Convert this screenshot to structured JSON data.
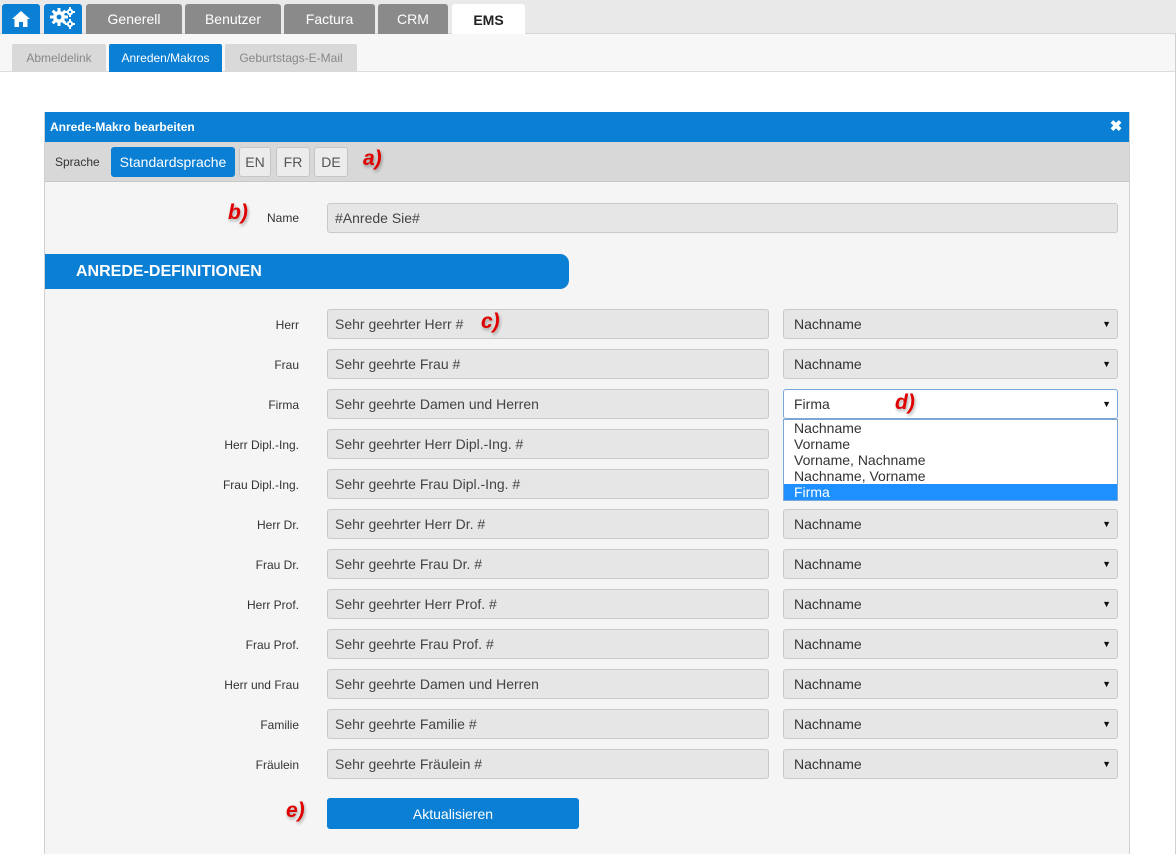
{
  "top_tabs": [
    "Generell",
    "Benutzer",
    "Factura",
    "CRM",
    "EMS"
  ],
  "sub_tabs": [
    "Abmeldelink",
    "Anreden/Makros",
    "Geburtstags-E-Mail"
  ],
  "dialog": {
    "title": "Anrede-Makro bearbeiten",
    "close_glyph": "✖",
    "language_label": "Sprache",
    "languages": [
      "Standardsprache",
      "EN",
      "FR",
      "DE"
    ],
    "name_label": "Name",
    "name_value": "#Anrede Sie#",
    "section_title": "ANREDE-DEFINITIONEN",
    "rows": [
      {
        "label": "Herr",
        "value": "Sehr geehrter Herr #",
        "select": "Nachname"
      },
      {
        "label": "Frau",
        "value": "Sehr geehrte Frau #",
        "select": "Nachname"
      },
      {
        "label": "Firma",
        "value": "Sehr geehrte Damen und Herren",
        "select": "Firma"
      },
      {
        "label": "Herr Dipl.-Ing.",
        "value": "Sehr geehrter Herr Dipl.-Ing. #",
        "select": "Nachname"
      },
      {
        "label": "Frau Dipl.-Ing.",
        "value": "Sehr geehrte Frau Dipl.-Ing. #",
        "select": "Nachname"
      },
      {
        "label": "Herr Dr.",
        "value": "Sehr geehrter Herr Dr. #",
        "select": "Nachname"
      },
      {
        "label": "Frau Dr.",
        "value": "Sehr geehrte Frau Dr. #",
        "select": "Nachname"
      },
      {
        "label": "Herr Prof.",
        "value": "Sehr geehrter Herr Prof. #",
        "select": "Nachname"
      },
      {
        "label": "Frau Prof.",
        "value": "Sehr geehrte Frau Prof. #",
        "select": "Nachname"
      },
      {
        "label": "Herr und Frau",
        "value": "Sehr geehrte Damen und Herren",
        "select": "Nachname"
      },
      {
        "label": "Familie",
        "value": "Sehr geehrte Familie #",
        "select": "Nachname"
      },
      {
        "label": "Fräulein",
        "value": "Sehr geehrte Fräulein #",
        "select": "Nachname"
      }
    ],
    "dropdown_options": [
      "Nachname",
      "Vorname",
      "Vorname, Nachname",
      "Nachname, Vorname",
      "Firma"
    ],
    "submit_label": "Aktualisieren"
  },
  "annotations": {
    "a": "a)",
    "b": "b)",
    "c": "c)",
    "d": "d)",
    "e": "e)"
  },
  "colors": {
    "accent": "#0a7fd4",
    "annotation": "#e00000",
    "tab_inactive": "#8a8a8a"
  }
}
